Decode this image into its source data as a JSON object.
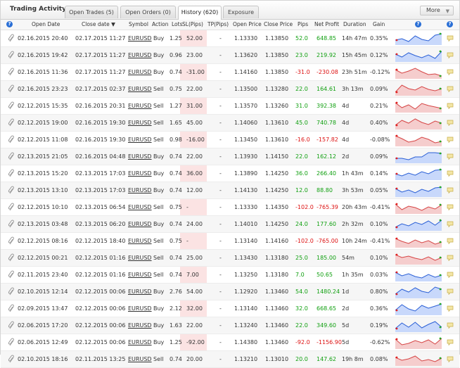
{
  "header": {
    "title": "Trading Activity",
    "tabs": [
      {
        "label": "Open Trades (5)",
        "active": false
      },
      {
        "label": "Open Orders (0)",
        "active": false
      },
      {
        "label": "History (620)",
        "active": true
      },
      {
        "label": "Exposure",
        "active": false
      }
    ],
    "more_label": "More",
    "more_arrow": "▼"
  },
  "columns": [
    "Open Date",
    "Close date ▼",
    "Symbol",
    "Action",
    "Lots",
    "SL(Pips)",
    "TP(Pips)",
    "Open Price",
    "Close Price",
    "Pips",
    "Net Profit",
    "Duration",
    "Gain"
  ],
  "help_icon": "?",
  "colors": {
    "profit": "#11a011",
    "loss": "#dd1111",
    "sl_highlight": "#fbe3e3",
    "chart_up": "#2a5fd6",
    "chart_down": "#d64545"
  },
  "rows": [
    {
      "open": "02.16.2015 20:40",
      "close": "02.17.2015 11:27",
      "symbol": "EURUSD",
      "action": "Buy",
      "lots": "1.25",
      "sl": "52.00",
      "tp": "-",
      "open_price": "1.13330",
      "close_price": "1.13850",
      "pips": "52.0",
      "profit": "648.85",
      "duration": "14h 47m",
      "gain": "0.35%",
      "positive": true
    },
    {
      "open": "02.16.2015 19:42",
      "close": "02.17.2015 11:27",
      "symbol": "EURUSD",
      "action": "Buy",
      "lots": "0.96",
      "sl": "23.00",
      "tp": "-",
      "open_price": "1.13620",
      "close_price": "1.13850",
      "pips": "23.0",
      "profit": "219.92",
      "duration": "15h 45m",
      "gain": "0.12%",
      "positive": true
    },
    {
      "open": "02.16.2015 11:36",
      "close": "02.17.2015 11:27",
      "symbol": "EURUSD",
      "action": "Buy",
      "lots": "0.74",
      "sl": "-31.00",
      "tp": "-",
      "open_price": "1.14160",
      "close_price": "1.13850",
      "pips": "-31.0",
      "profit": "-230.08",
      "duration": "23h 51m",
      "gain": "-0.12%",
      "positive": false
    },
    {
      "open": "02.16.2015 23:23",
      "close": "02.17.2015 02:37",
      "symbol": "EURUSD",
      "action": "Sell",
      "lots": "0.75",
      "sl": "22.00",
      "tp": "-",
      "open_price": "1.13500",
      "close_price": "1.13280",
      "pips": "22.0",
      "profit": "164.61",
      "duration": "3h 13m",
      "gain": "0.09%",
      "positive": true
    },
    {
      "open": "02.12.2015 15:35",
      "close": "02.16.2015 20:31",
      "symbol": "EURUSD",
      "action": "Sell",
      "lots": "1.27",
      "sl": "31.00",
      "tp": "-",
      "open_price": "1.13570",
      "close_price": "1.13260",
      "pips": "31.0",
      "profit": "392.38",
      "duration": "4d",
      "gain": "0.21%",
      "positive": true
    },
    {
      "open": "02.12.2015 19:00",
      "close": "02.16.2015 19:30",
      "symbol": "EURUSD",
      "action": "Sell",
      "lots": "1.65",
      "sl": "45.00",
      "tp": "-",
      "open_price": "1.14060",
      "close_price": "1.13610",
      "pips": "45.0",
      "profit": "740.78",
      "duration": "4d",
      "gain": "0.40%",
      "positive": true
    },
    {
      "open": "02.12.2015 11:08",
      "close": "02.16.2015 19:30",
      "symbol": "EURUSD",
      "action": "Sell",
      "lots": "0.98",
      "sl": "-16.00",
      "tp": "-",
      "open_price": "1.13450",
      "close_price": "1.13610",
      "pips": "-16.0",
      "profit": "-157.82",
      "duration": "4d",
      "gain": "-0.08%",
      "positive": false
    },
    {
      "open": "02.13.2015 21:05",
      "close": "02.16.2015 04:48",
      "symbol": "EURUSD",
      "action": "Buy",
      "lots": "0.74",
      "sl": "22.00",
      "tp": "-",
      "open_price": "1.13930",
      "close_price": "1.14150",
      "pips": "22.0",
      "profit": "162.12",
      "duration": "2d",
      "gain": "0.09%",
      "positive": true
    },
    {
      "open": "02.13.2015 15:20",
      "close": "02.13.2015 17:03",
      "symbol": "EURUSD",
      "action": "Buy",
      "lots": "0.74",
      "sl": "36.00",
      "tp": "-",
      "open_price": "1.13890",
      "close_price": "1.14250",
      "pips": "36.0",
      "profit": "266.40",
      "duration": "1h 43m",
      "gain": "0.14%",
      "positive": true
    },
    {
      "open": "02.13.2015 13:10",
      "close": "02.13.2015 17:03",
      "symbol": "EURUSD",
      "action": "Buy",
      "lots": "0.74",
      "sl": "12.00",
      "tp": "-",
      "open_price": "1.14130",
      "close_price": "1.14250",
      "pips": "12.0",
      "profit": "88.80",
      "duration": "3h 53m",
      "gain": "0.05%",
      "positive": true
    },
    {
      "open": "02.12.2015 10:10",
      "close": "02.13.2015 06:54",
      "symbol": "EURUSD",
      "action": "Sell",
      "lots": "0.75",
      "sl": "-",
      "tp": "-",
      "open_price": "1.13330",
      "close_price": "1.14350",
      "pips": "-102.0",
      "profit": "-765.39",
      "duration": "20h 43m",
      "gain": "-0.41%",
      "positive": false
    },
    {
      "open": "02.13.2015 03:48",
      "close": "02.13.2015 06:20",
      "symbol": "EURUSD",
      "action": "Buy",
      "lots": "0.74",
      "sl": "24.00",
      "tp": "-",
      "open_price": "1.14010",
      "close_price": "1.14250",
      "pips": "24.0",
      "profit": "177.60",
      "duration": "2h 32m",
      "gain": "0.10%",
      "positive": true
    },
    {
      "open": "02.12.2015 08:16",
      "close": "02.12.2015 18:40",
      "symbol": "EURUSD",
      "action": "Sell",
      "lots": "0.75",
      "sl": "-",
      "tp": "-",
      "open_price": "1.13140",
      "close_price": "1.14160",
      "pips": "-102.0",
      "profit": "-765.00",
      "duration": "10h 24m",
      "gain": "-0.41%",
      "positive": false
    },
    {
      "open": "02.12.2015 00:21",
      "close": "02.12.2015 01:16",
      "symbol": "EURUSD",
      "action": "Sell",
      "lots": "0.74",
      "sl": "25.00",
      "tp": "-",
      "open_price": "1.13430",
      "close_price": "1.13180",
      "pips": "25.0",
      "profit": "185.00",
      "duration": "54m",
      "gain": "0.10%",
      "positive": true
    },
    {
      "open": "02.11.2015 23:40",
      "close": "02.12.2015 01:16",
      "symbol": "EURUSD",
      "action": "Sell",
      "lots": "0.74",
      "sl": "7.00",
      "tp": "-",
      "open_price": "1.13250",
      "close_price": "1.13180",
      "pips": "7.0",
      "profit": "50.65",
      "duration": "1h 35m",
      "gain": "0.03%",
      "positive": true
    },
    {
      "open": "02.10.2015 12:14",
      "close": "02.12.2015 00:06",
      "symbol": "EURUSD",
      "action": "Buy",
      "lots": "2.76",
      "sl": "54.00",
      "tp": "-",
      "open_price": "1.12920",
      "close_price": "1.13460",
      "pips": "54.0",
      "profit": "1480.24",
      "duration": "1d",
      "gain": "0.80%",
      "positive": true
    },
    {
      "open": "02.09.2015 13:47",
      "close": "02.12.2015 00:06",
      "symbol": "EURUSD",
      "action": "Buy",
      "lots": "2.12",
      "sl": "32.00",
      "tp": "-",
      "open_price": "1.13140",
      "close_price": "1.13460",
      "pips": "32.0",
      "profit": "668.65",
      "duration": "2d",
      "gain": "0.36%",
      "positive": true
    },
    {
      "open": "02.06.2015 17:20",
      "close": "02.12.2015 00:06",
      "symbol": "EURUSD",
      "action": "Buy",
      "lots": "1.63",
      "sl": "22.00",
      "tp": "-",
      "open_price": "1.13240",
      "close_price": "1.13460",
      "pips": "22.0",
      "profit": "349.60",
      "duration": "5d",
      "gain": "0.19%",
      "positive": true
    },
    {
      "open": "02.06.2015 12:49",
      "close": "02.12.2015 00:06",
      "symbol": "EURUSD",
      "action": "Buy",
      "lots": "1.25",
      "sl": "-92.00",
      "tp": "-",
      "open_price": "1.14380",
      "close_price": "1.13460",
      "pips": "-92.0",
      "profit": "-1156.90",
      "duration": "5d",
      "gain": "-0.62%",
      "positive": false
    },
    {
      "open": "02.10.2015 18:16",
      "close": "02.11.2015 13:25",
      "symbol": "EURUSD",
      "action": "Sell",
      "lots": "0.74",
      "sl": "20.00",
      "tp": "-",
      "open_price": "1.13210",
      "close_price": "1.13010",
      "pips": "20.0",
      "profit": "147.62",
      "duration": "19h 8m",
      "gain": "0.08%",
      "positive": true
    }
  ]
}
